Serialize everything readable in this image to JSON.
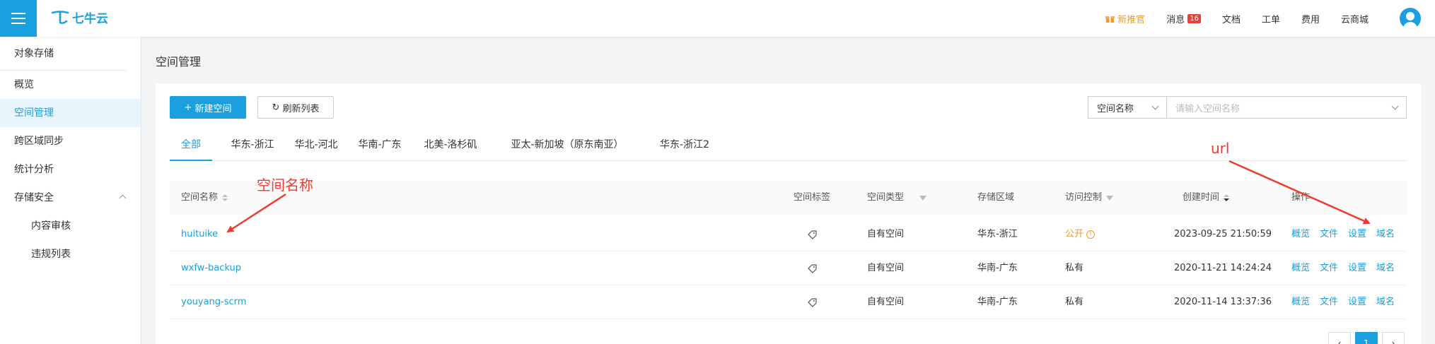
{
  "header": {
    "logo_text": "七牛云",
    "nav": [
      {
        "label": "新推官",
        "icon": "gift-icon"
      },
      {
        "label": "消息",
        "badge": "16"
      },
      {
        "label": "文档"
      },
      {
        "label": "工单"
      },
      {
        "label": "费用"
      },
      {
        "label": "云商城"
      }
    ]
  },
  "sidebar": {
    "title": "对象存储",
    "items": [
      {
        "label": "概览"
      },
      {
        "label": "空间管理",
        "active": true
      },
      {
        "label": "跨区域同步"
      },
      {
        "label": "统计分析"
      },
      {
        "label": "存储安全",
        "expanded": true
      },
      {
        "label": "内容审核"
      },
      {
        "label": "违规列表"
      }
    ]
  },
  "page": {
    "title": "空间管理",
    "new_bucket_label": "新建空间",
    "refresh_label": "刷新列表",
    "search_select_value": "空间名称",
    "search_placeholder": "请输入空间名称"
  },
  "tabs": [
    "全部",
    "华东-浙江",
    "华北-河北",
    "华南-广东",
    "北美-洛杉矶",
    "亚太-新加坡（原东南亚）",
    "华东-浙江2"
  ],
  "table": {
    "columns": [
      "空间名称",
      "空间标签",
      "空间类型",
      "存储区域",
      "访问控制",
      "创建时间",
      "操作"
    ],
    "rows": [
      {
        "name": "huituike",
        "type": "自有空间",
        "region": "华东-浙江",
        "access": "公开",
        "created": "2023-09-25 21:50:59"
      },
      {
        "name": "wxfw-backup",
        "type": "自有空间",
        "region": "华南-广东",
        "access": "私有",
        "created": "2020-11-21 14:24:24"
      },
      {
        "name": "youyang-scrm",
        "type": "自有空间",
        "region": "华南-广东",
        "access": "私有",
        "created": "2020-11-14 13:37:36"
      }
    ],
    "actions": [
      "概览",
      "文件",
      "设置",
      "域名"
    ]
  },
  "pagination": {
    "current": "1"
  },
  "annotations": {
    "name_label": "空间名称",
    "url_label": "url",
    "color": "#ef3b2d"
  }
}
